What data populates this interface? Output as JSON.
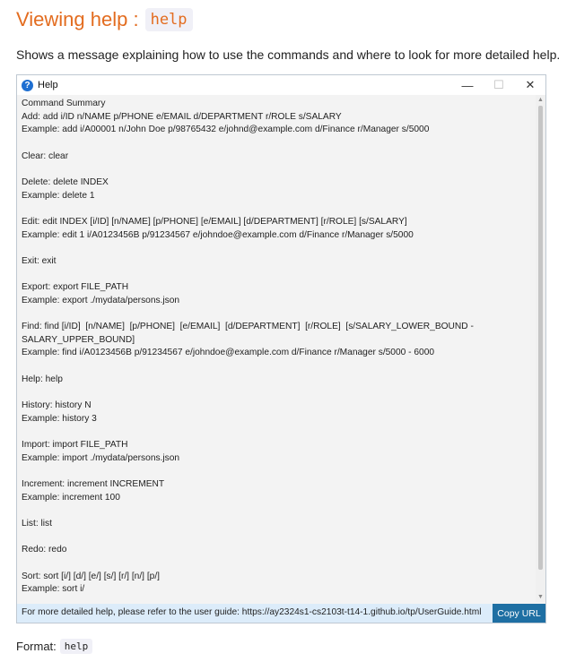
{
  "heading": {
    "prefix": "Viewing help : ",
    "code": "help"
  },
  "description": "Shows a message explaining how to use the commands and where to look for more detailed help.",
  "window": {
    "title": "Help",
    "controls": {
      "minimize": "—",
      "maximize": "☐",
      "close": "✕"
    },
    "content": "Command Summary\nAdd: add i/ID n/NAME p/PHONE e/EMAIL d/DEPARTMENT r/ROLE s/SALARY\nExample: add i/A00001 n/John Doe p/98765432 e/johnd@example.com d/Finance r/Manager s/5000\n\nClear: clear\n\nDelete: delete INDEX\nExample: delete 1\n\nEdit: edit INDEX [i/ID] [n/NAME] [p/PHONE] [e/EMAIL] [d/DEPARTMENT] [r/ROLE] [s/SALARY]\nExample: edit 1 i/A0123456B p/91234567 e/johndoe@example.com d/Finance r/Manager s/5000\n\nExit: exit\n\nExport: export FILE_PATH\nExample: export ./mydata/persons.json\n\nFind: find [i/ID]  [n/NAME]  [p/PHONE]  [e/EMAIL]  [d/DEPARTMENT]  [r/ROLE]  [s/SALARY_LOWER_BOUND -\nSALARY_UPPER_BOUND]\nExample: find i/A0123456B p/91234567 e/johndoe@example.com d/Finance r/Manager s/5000 - 6000\n\nHelp: help\n\nHistory: history N\nExample: history 3\n\nImport: import FILE_PATH\nExample: import ./mydata/persons.json\n\nIncrement: increment INCREMENT\nExample: increment 100\n\nList: list\n\nRedo: redo\n\nSort: sort [i/] [d/] [e/] [s/] [r/] [n/] [p/]\nExample: sort i/",
    "footer_message": "For more detailed help, please refer to the user guide: https://ay2324s1-cs2103t-t14-1.github.io/tp/UserGuide.html",
    "copy_button": "Copy URL"
  },
  "format": {
    "label": "Format:",
    "code": "help"
  },
  "colors": {
    "heading": "#e36c1f",
    "copy_button": "#1e6fa3",
    "footer_bg": "#dcecfa"
  }
}
